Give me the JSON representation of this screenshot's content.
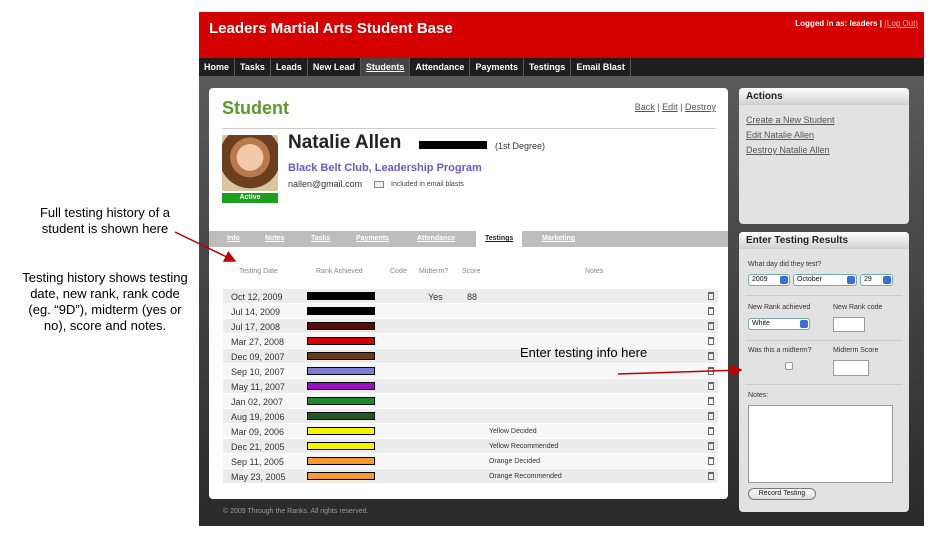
{
  "annotations": {
    "history_shown": "Full testing history of a student is shown here",
    "history_fields": "Testing history shows testing date, new rank, rank code (eg. “9D”), midterm (yes or no), score and notes.",
    "enter_info": "Enter testing info here"
  },
  "app": {
    "title": "Leaders Martial Arts Student Base",
    "login_text": "Logged in as: leaders |",
    "logout_label": "(Log Out)"
  },
  "nav": [
    "Home",
    "Tasks",
    "Leads",
    "New Lead",
    "Students",
    "Attendance",
    "Payments",
    "Testings",
    "Email Blast"
  ],
  "nav_active": "Students",
  "student": {
    "heading": "Student",
    "actions": [
      "Back",
      "Edit",
      "Destroy"
    ],
    "name": "Natalie Allen",
    "degree": "(1st Degree)",
    "programs": "Black Belt Club, Leadership Program",
    "email": "nallen@gmail.com",
    "email_note": "Included in email blasts",
    "status": "Active"
  },
  "tabs": [
    "Info",
    "Notes",
    "Tasks",
    "Payments",
    "Attendance",
    "Testings",
    "Marketing"
  ],
  "tab_active": "Testings",
  "columns": {
    "date": "Testing Date",
    "rank": "Rank Achieved",
    "code": "Code",
    "midterm": "Midterm?",
    "score": "Score",
    "notes": "Notes"
  },
  "testings": [
    {
      "date": "Oct 12, 2009",
      "rank_color": "#000000",
      "midterm": "Yes",
      "score": "88",
      "notes": ""
    },
    {
      "date": "Jul 14, 2009",
      "rank_color": "#000000",
      "midterm": "",
      "score": "",
      "notes": ""
    },
    {
      "date": "Jul 17, 2008",
      "rank_color": "#5a0a0a",
      "midterm": "",
      "score": "",
      "notes": ""
    },
    {
      "date": "Mar 27, 2008",
      "rank_color": "#d40000",
      "midterm": "",
      "score": "",
      "notes": ""
    },
    {
      "date": "Dec 09, 2007",
      "rank_color": "#6b3a12",
      "midterm": "",
      "score": "",
      "notes": ""
    },
    {
      "date": "Sep 10, 2007",
      "rank_color": "#7b7bd8",
      "midterm": "",
      "score": "",
      "notes": ""
    },
    {
      "date": "May 11, 2007",
      "rank_color": "#9a10c0",
      "midterm": "",
      "score": "",
      "notes": ""
    },
    {
      "date": "Jan 02, 2007",
      "rank_color": "#1a8a2a",
      "midterm": "",
      "score": "",
      "notes": ""
    },
    {
      "date": "Aug 19, 2006",
      "rank_color": "#1e5a1e",
      "midterm": "",
      "score": "",
      "notes": ""
    },
    {
      "date": "Mar 09, 2006",
      "rank_color": "#f5f500",
      "midterm": "",
      "score": "",
      "notes": "Yellow Decided"
    },
    {
      "date": "Dec 21, 2005",
      "rank_color": "#f5f500",
      "midterm": "",
      "score": "",
      "notes": "Yellow Recommended"
    },
    {
      "date": "Sep 11, 2005",
      "rank_color": "#f59a30",
      "midterm": "",
      "score": "",
      "notes": "Orange Decided"
    },
    {
      "date": "May 23, 2005",
      "rank_color": "#f59a30",
      "midterm": "",
      "score": "",
      "notes": "Orange Recommended"
    }
  ],
  "footer": "© 2009 Through the Ranks. All rights reserved.",
  "actions_panel": {
    "title": "Actions",
    "links": [
      "Create a New Student",
      "Edit Natalie Allen",
      "Destroy Natalie Allen"
    ]
  },
  "testing_panel": {
    "title": "Enter Testing Results",
    "date_label": "What day did they test?",
    "year": "2009",
    "month": "October",
    "day": "29",
    "rank_label": "New Rank achieved",
    "rank_value": "White",
    "code_label": "New Rank code",
    "midterm_label": "Was this a midterm?",
    "score_label": "Midterm Score",
    "notes_label": "Notes:",
    "submit_label": "Record Testing"
  },
  "colors": {
    "header_red": "#d40000",
    "accent_green": "#5a9a2a",
    "link_purple": "#6a5acd"
  }
}
